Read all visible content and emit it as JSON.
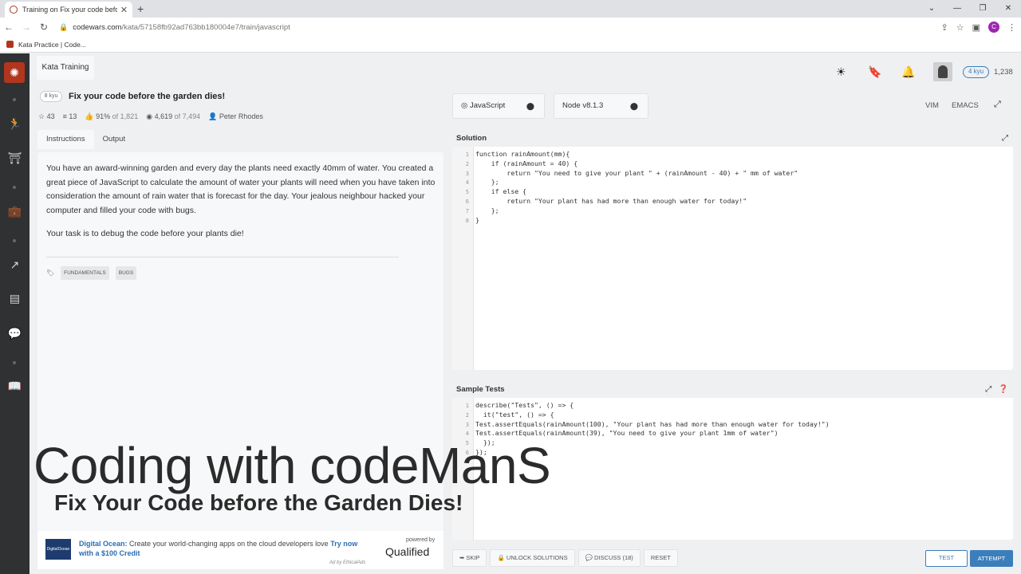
{
  "browser": {
    "tab_title": "Training on Fix your code before",
    "url_host": "codewars.com",
    "url_path": "/kata/57158fb92ad763bb180004e7/train/javascript",
    "bookmark": "Kata Practice | Code...",
    "profile_initial": "C"
  },
  "header": {
    "kata_training": "Kata Training",
    "user_rank": "4 kyu",
    "honor": "1,238"
  },
  "kata": {
    "rank": "8 kyu",
    "title": "Fix your code before the garden dies!",
    "stars": "43",
    "collections": "13",
    "satisfaction": "91%",
    "satisfaction_of": "of 1,821",
    "completed": "4,619",
    "completed_of": "of 7,494",
    "author": "Peter Rhodes"
  },
  "tabs": [
    "Instructions",
    "Output"
  ],
  "description": {
    "p1": "You have an award-winning garden and every day the plants need exactly 40mm of water. You created a great piece of JavaScript to calculate the amount of water your plants will need when you have taken into consideration the amount of rain water that is forecast for the day. Your jealous neighbour hacked your computer and filled your code with bugs.",
    "p2": "Your task is to debug the code before your plants die!",
    "tags": [
      "FUNDAMENTALS",
      "BUGS"
    ]
  },
  "ad": {
    "brand": "Digital Ocean:",
    "text": "Create your world-changing apps on the cloud developers love",
    "cta": "Try now with a $100 Credit",
    "logo_text": "DigitalOcean",
    "powered_by": "powered by",
    "qualified": "Qualified",
    "ethical": "Ad by EthicalAds"
  },
  "editor_settings": {
    "language": "JavaScript",
    "version": "Node v8.1.3",
    "vim": "VIM",
    "emacs": "EMACS"
  },
  "solution": {
    "title": "Solution",
    "lines": [
      {
        "n": "1",
        "t": "function rainAmount(mm){"
      },
      {
        "n": "2",
        "t": "    if (rainAmount = 40) {"
      },
      {
        "n": "3",
        "t": "        return \"You need to give your plant \" + (rainAmount - 40) + \" mm of water\""
      },
      {
        "n": "4",
        "t": "    };"
      },
      {
        "n": "5",
        "t": "    if else {"
      },
      {
        "n": "6",
        "t": "        return \"Your plant has had more than enough water for today!\""
      },
      {
        "n": "7",
        "t": "    };"
      },
      {
        "n": "8",
        "t": "}"
      }
    ]
  },
  "tests": {
    "title": "Sample Tests",
    "lines": [
      {
        "n": "1",
        "t": "describe(\"Tests\", () => {"
      },
      {
        "n": "2",
        "t": "  it(\"test\", () => {"
      },
      {
        "n": "3",
        "t": "Test.assertEquals(rainAmount(100), \"Your plant has had more than enough water for today!\")"
      },
      {
        "n": "4",
        "t": "Test.assertEquals(rainAmount(39), \"You need to give your plant 1mm of water\")"
      },
      {
        "n": "5",
        "t": "  });"
      },
      {
        "n": "6",
        "t": "});"
      }
    ]
  },
  "actions": {
    "skip": "SKIP",
    "unlock": "UNLOCK SOLUTIONS",
    "discuss": "DISCUSS (18)",
    "reset": "RESET",
    "test": "TEST",
    "attempt": "ATTEMPT"
  },
  "overlay": {
    "title": "Coding with codeManS",
    "subtitle": "Fix Your Code before the Garden Dies!"
  },
  "colors": {
    "brand_red": "#b1361e",
    "accent_blue": "#3c7ebb",
    "sidebar": "#303133"
  }
}
